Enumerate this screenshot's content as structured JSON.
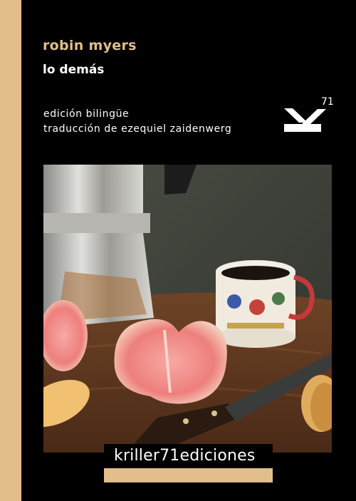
{
  "cover": {
    "author": "robin myers",
    "title": "lo demás",
    "edition": "edición bilingüe",
    "translation": "traducción de ezequiel zaidenwerg",
    "logo_number": "71",
    "publisher": "kriller71ediciones"
  },
  "colors": {
    "accent": "#e2be8a",
    "background": "#000000",
    "text": "#ffffff"
  },
  "icons": {
    "logo": "k-logo-icon",
    "photo": "still-life-photo"
  }
}
